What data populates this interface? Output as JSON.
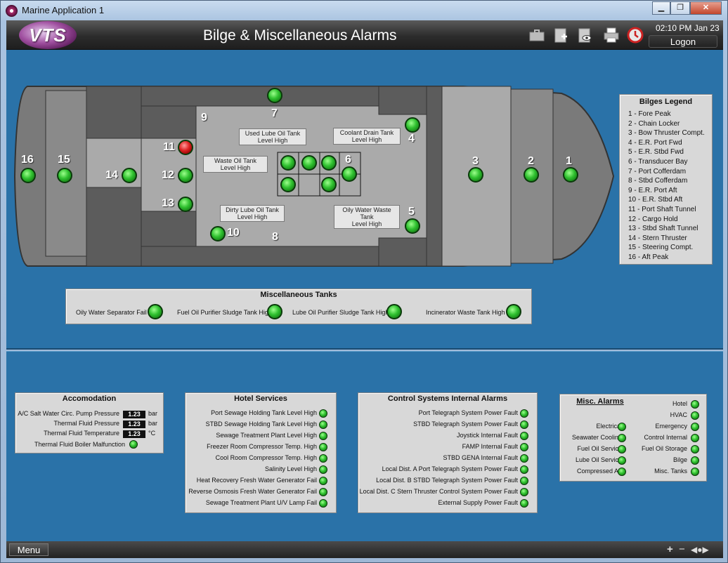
{
  "window": {
    "title": "Marine Application 1",
    "min": "▁",
    "max": "❐",
    "close": "✕"
  },
  "header": {
    "logo": "VTS",
    "title": "Bilge & Miscellaneous Alarms",
    "clock": "02:10 PM Jan 23",
    "logon": "Logon"
  },
  "icons": [
    "briefcase-icon",
    "add-page-icon",
    "view-page-icon",
    "printer-icon",
    "alarm-stop-icon"
  ],
  "colors": {
    "alarm_ok": "#2fc02f",
    "alarm_active": "#dd2222",
    "panel": "#d8d8d8",
    "background": "#2a72a8"
  },
  "ship": {
    "numbers": [
      "16",
      "15",
      "14",
      "12",
      "13",
      "11",
      "10",
      "9",
      "8",
      "7",
      "6",
      "5",
      "4",
      "3",
      "2",
      "1"
    ],
    "tanks": {
      "used_lube": [
        "Used Lube Oil Tank",
        "Level High"
      ],
      "coolant": [
        "Coolant Drain Tank",
        "Level High"
      ],
      "waste_oil": [
        "Waste Oil Tank",
        "Level High"
      ],
      "dirty_lube": [
        "Dirty Lube Oil Tank",
        "Level High"
      ],
      "oily_water": [
        "Oily Water Waste Tank",
        "Level High"
      ]
    }
  },
  "legend": {
    "title": "Bilges Legend",
    "items": [
      "1 - Fore Peak",
      "2 - Chain Locker",
      "3 - Bow Thruster Compt.",
      "4 - E.R. Port Fwd",
      "5 - E.R. Stbd Fwd",
      "6 - Transducer Bay",
      "7 - Port Cofferdam",
      "8 - Stbd Cofferdam",
      "9 - E.R. Port Aft",
      "10 - E.R. Stbd Aft",
      "11 - Port Shaft Tunnel",
      "12 - Cargo Hold",
      "13 - Stbd Shaft Tunnel",
      "14 - Stern Thruster",
      "15 - Steering Compt.",
      "16 - Aft Peak"
    ]
  },
  "misc_tanks": {
    "title": "Miscellaneous Tanks",
    "items": [
      "Oily Water Separator Fail",
      "Fuel Oil Purifier Sludge Tank High",
      "Lube Oil Purifier Sludge Tank High",
      "Incinerator Waste Tank  High"
    ]
  },
  "accom": {
    "title": "Accomodation",
    "rows": [
      {
        "label": "A/C Salt Water Circ. Pump Pressure",
        "value": "1.23",
        "unit": "bar"
      },
      {
        "label": "Thermal Fluid Pressure",
        "value": "1.23",
        "unit": "bar"
      },
      {
        "label": "Thermal Fluid Temperature",
        "value": "1.23",
        "unit": "°C"
      }
    ],
    "malfunction": "Thermal Fluid Boiler Malfunction"
  },
  "hotel": {
    "title": "Hotel Services",
    "items": [
      "Port Sewage Holding Tank Level High",
      "STBD Sewage Holding Tank Level High",
      "Sewage Treatment Plant Level High",
      "Freezer Room Compressor Temp. High",
      "Cool Room Compressor Temp. High",
      "Salinity Level High",
      "Heat Recovery Fresh Water Generator Fail",
      "Reverse Osmosis Fresh Water Generator Fail",
      "Sewage Treatment Plant U/V Lamp Fail"
    ]
  },
  "control": {
    "title": "Control Systems Internal Alarms",
    "items": [
      "Port Telegraph System Power Fault",
      "STBD Telegraph System Power Fault",
      "Joystick Internal Fault",
      "FAMP Internal Fault",
      "STBD GENA Internal Fault",
      "Local Dist. A Port Telegraph System Power Fault",
      "Local Dist. B STBD Telegraph System Power Fault",
      "Local Dist. C Stern Thruster Control System Power Fault",
      "External Supply Power Fault"
    ]
  },
  "misc_alarms": {
    "title": "Misc. Alarms",
    "left": [
      "Electrical",
      "Seawater Cooling",
      "Fuel Oil Service",
      "Lube Oil Service",
      "Compressed Air"
    ],
    "right": [
      "Hotel",
      "HVAC",
      "Emergency",
      "Control Internal",
      "Fuel Oil Storage",
      "Bilge",
      "Misc. Tanks"
    ]
  },
  "footer": {
    "menu": "Menu",
    "plus": "+",
    "minus": "−",
    "nav": "◀●▶"
  }
}
